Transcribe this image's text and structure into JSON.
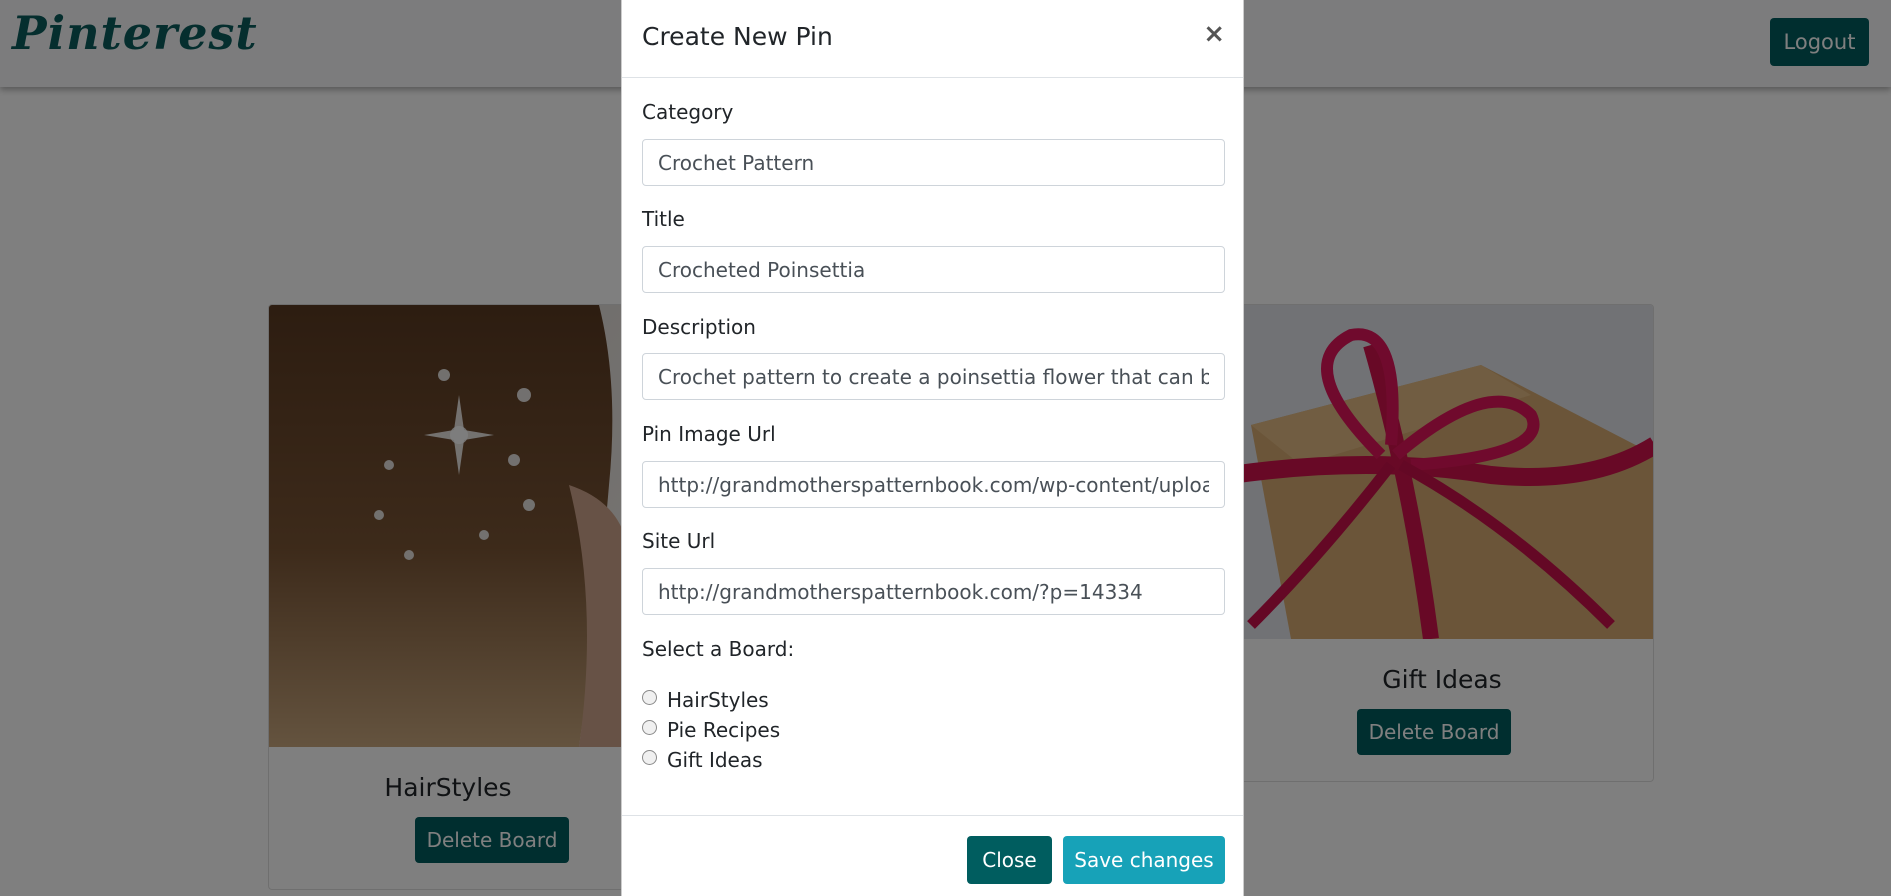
{
  "navbar": {
    "brand": "Pinterest",
    "logout_label": "Logout"
  },
  "boards": [
    {
      "title": "HairStyles",
      "delete_label": "Delete Board"
    },
    {
      "title": "Gift Ideas",
      "delete_label": "Delete Board"
    }
  ],
  "modal": {
    "title": "Create New Pin",
    "close_icon": "×",
    "fields": {
      "category": {
        "label": "Category",
        "value": "Crochet Pattern"
      },
      "title": {
        "label": "Title",
        "value": "Crocheted Poinsettia"
      },
      "description": {
        "label": "Description",
        "value": "Crochet pattern to create a poinsettia flower that can be used"
      },
      "pin_image_url": {
        "label": "Pin Image Url",
        "value": "http://grandmotherspatternbook.com/wp-content/uploads"
      },
      "site_url": {
        "label": "Site Url",
        "value": "http://grandmotherspatternbook.com/?p=14334"
      }
    },
    "board_select_label": "Select a Board:",
    "board_options": [
      "HairStyles",
      "Pie Recipes",
      "Gift Ideas"
    ],
    "close_label": "Close",
    "save_label": "Save changes"
  },
  "colors": {
    "primary": "#005d5f",
    "info": "#17a2b8",
    "brand": "#0b5c5c"
  }
}
